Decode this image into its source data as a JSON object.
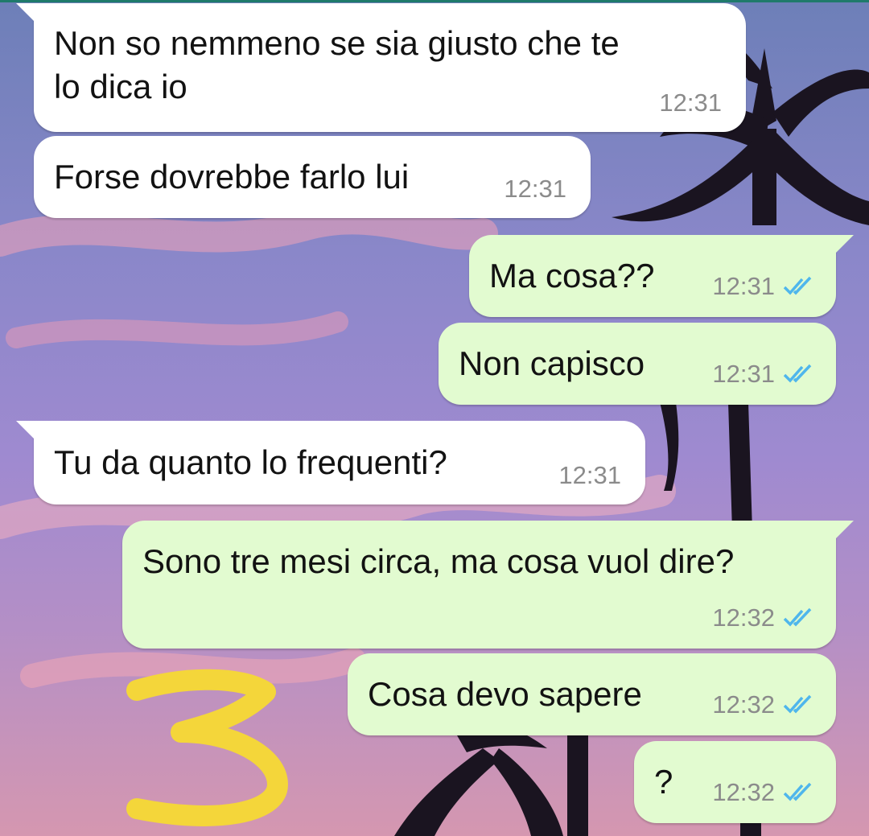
{
  "chat": {
    "messages": [
      {
        "direction": "incoming",
        "text": "Non so nemmeno se sia giusto che te\nlo dica io",
        "time": "12:31",
        "status": ""
      },
      {
        "direction": "incoming",
        "text": "Forse dovrebbe farlo lui",
        "time": "12:31",
        "status": ""
      },
      {
        "direction": "outgoing",
        "text": "Ma cosa??",
        "time": "12:31",
        "status": "read"
      },
      {
        "direction": "outgoing",
        "text": "Non capisco",
        "time": "12:31",
        "status": "read"
      },
      {
        "direction": "incoming",
        "text": "Tu da quanto lo frequenti?",
        "time": "12:31",
        "status": ""
      },
      {
        "direction": "outgoing",
        "text": "Sono tre mesi circa, ma cosa vuol dire?",
        "time": "12:32",
        "status": "read"
      },
      {
        "direction": "outgoing",
        "text": "Cosa devo sapere",
        "time": "12:32",
        "status": "read"
      },
      {
        "direction": "outgoing",
        "text": "?",
        "time": "12:32",
        "status": "read"
      }
    ]
  },
  "annotation": {
    "text": "3",
    "color": "#f4d63a"
  },
  "colors": {
    "incoming_bubble": "#ffffff",
    "outgoing_bubble": "#e2fbd0",
    "read_ticks": "#4fb6ec",
    "timestamp": "#8b8b8b"
  },
  "icons": {
    "read_receipt": "double-check-icon"
  }
}
